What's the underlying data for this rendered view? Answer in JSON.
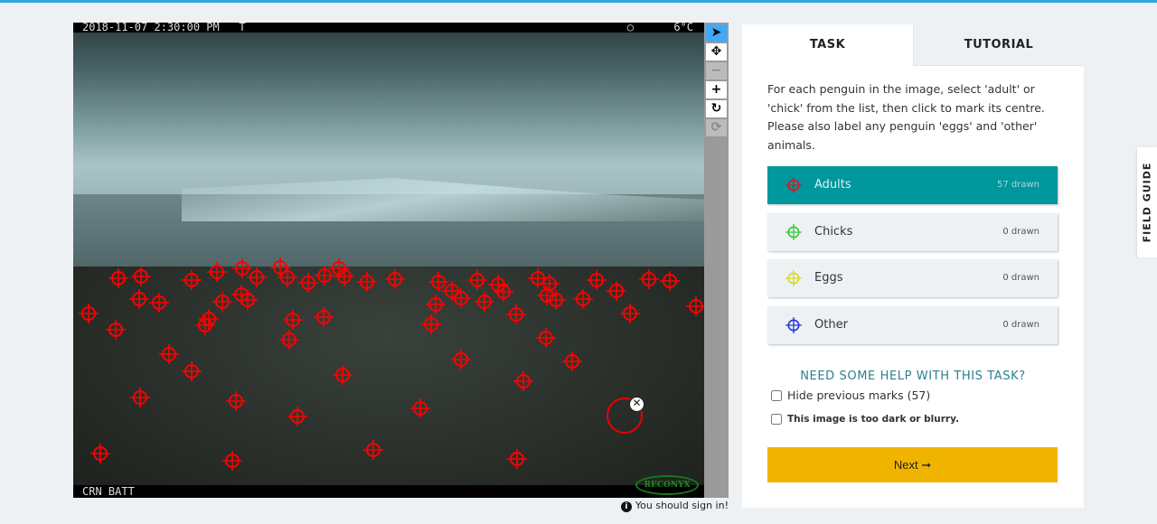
{
  "viewer": {
    "timestamp": "2018-11-07 2:30:00 PM   T",
    "moon": "○",
    "temperature": "6°C",
    "footer": "CRN BATT",
    "camera_logo": "RECONYX",
    "tools": [
      "pointer-tool",
      "move-tool",
      "zoom-out",
      "zoom-in",
      "rotate",
      "reset"
    ],
    "mark_color": "#ff0000"
  },
  "signin": {
    "icon": "info-icon",
    "text": "You should sign in!"
  },
  "panel": {
    "tabs": [
      {
        "label": "TASK"
      },
      {
        "label": "TUTORIAL"
      }
    ],
    "instructions": "For each penguin in the image, select 'adult' or 'chick' from the list, then click to mark its centre. Please also label any penguin 'eggs' and 'other' animals.",
    "tools": [
      {
        "label": "Adults",
        "count": "57 drawn",
        "color": "#e0141e"
      },
      {
        "label": "Chicks",
        "count": "0 drawn",
        "color": "#33cc33"
      },
      {
        "label": "Eggs",
        "count": "0 drawn",
        "color": "#d8d820"
      },
      {
        "label": "Other",
        "count": "0 drawn",
        "color": "#2233dd"
      }
    ],
    "help": "NEED SOME HELP WITH THIS TASK?",
    "hide_marks": "Hide previous marks (57)",
    "too_dark": "This image is too dark or blurry.",
    "next": "Next ➞"
  },
  "field_guide": "FIELD GUIDE"
}
